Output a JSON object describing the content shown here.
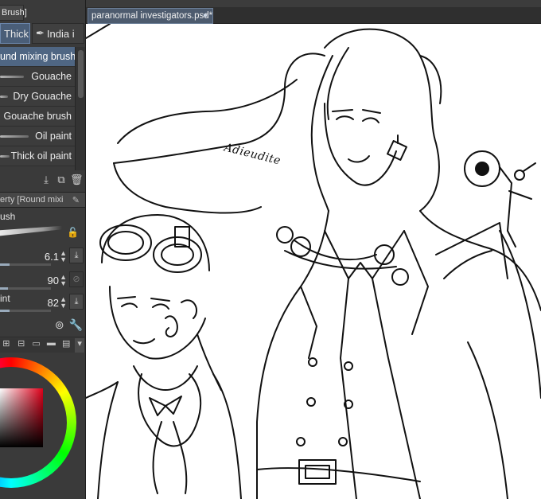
{
  "brush_panel": {
    "header": "Brush]",
    "tabs": [
      {
        "label": "Thick",
        "active": true
      },
      {
        "label": "India i",
        "active": false
      }
    ],
    "brushes": [
      {
        "label": "und mixing brush",
        "selected": true
      },
      {
        "label": "Gouache",
        "selected": false
      },
      {
        "label": "Dry Gouache",
        "selected": false
      },
      {
        "label": "Gouache brush",
        "selected": false
      },
      {
        "label": "Oil paint",
        "selected": false
      },
      {
        "label": "Thick oil paint",
        "selected": false
      }
    ]
  },
  "property_panel": {
    "header": "erty [Round mixi",
    "brush_name": "ush",
    "rows": [
      {
        "label": "",
        "value": "6.1"
      },
      {
        "label": "",
        "value": "90"
      },
      {
        "label": "int",
        "value": "82"
      }
    ]
  },
  "document": {
    "tab_title": "paranormal investigators.psd*",
    "tab_marker": "●"
  },
  "canvas": {
    "signature": "Adieudite"
  },
  "colors": {
    "accent": "#4f6683",
    "panel_bg": "#3a3a3a",
    "canvas_bg": "#ffffff",
    "main_color": "#e0001a"
  }
}
